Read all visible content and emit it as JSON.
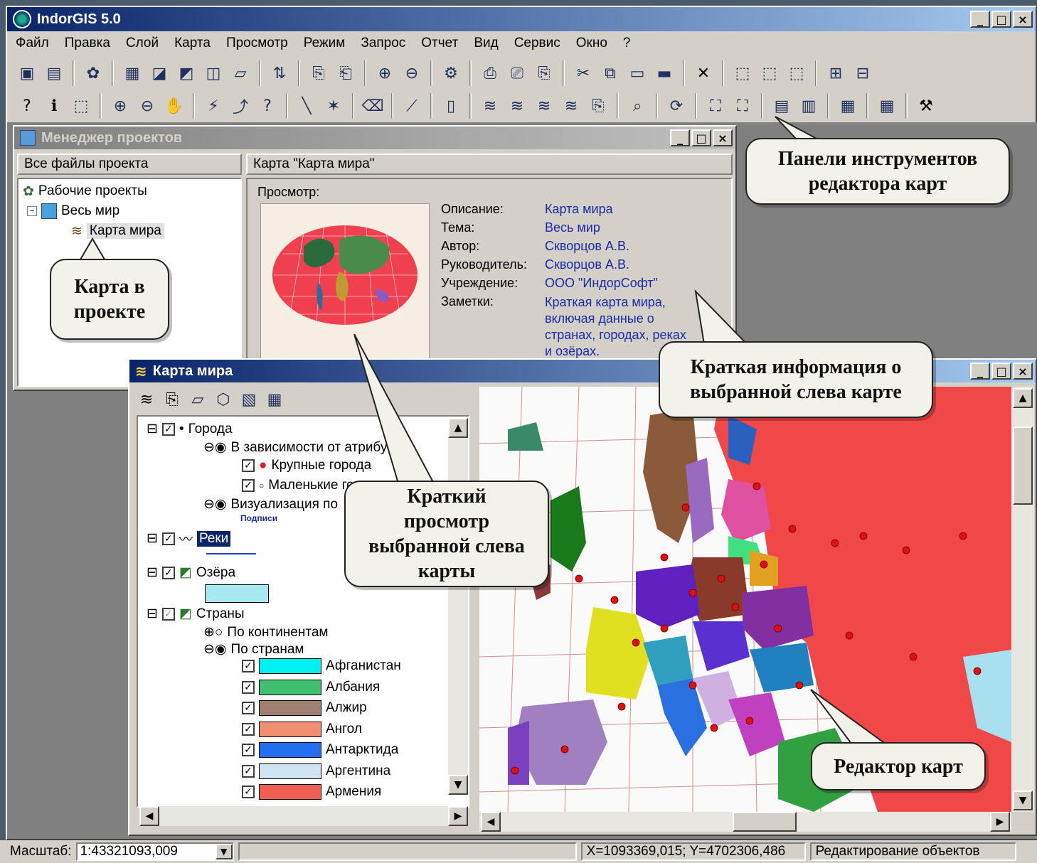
{
  "app": {
    "title": "IndorGIS 5.0"
  },
  "menu": [
    "Файл",
    "Правка",
    "Слой",
    "Карта",
    "Просмотр",
    "Режим",
    "Запрос",
    "Отчет",
    "Вид",
    "Сервис",
    "Окно",
    "?"
  ],
  "project_manager": {
    "title": "Менеджер проектов",
    "left_header": "Все файлы проекта",
    "right_header": "Карта \"Карта мира\"",
    "tree": [
      "Рабочие проекты",
      "Весь мир",
      "Карта мира"
    ],
    "preview_label": "Просмотр:",
    "info": [
      {
        "label": "Описание:",
        "value": "Карта мира"
      },
      {
        "label": "Тема:",
        "value": "Весь мир"
      },
      {
        "label": "Автор:",
        "value": "Скворцов А.В."
      },
      {
        "label": "Руководитель:",
        "value": "Скворцов А.В."
      },
      {
        "label": "Учреждение:",
        "value": "ООО \"ИндорСофт\""
      },
      {
        "label": "Заметки:",
        "value": "Краткая карта мира, включая данные о странах, городах, реках и озёрах."
      }
    ]
  },
  "map_window": {
    "title": "Карта мира",
    "layers": {
      "cities": "Города",
      "by_attr": "В зависимости от атрибута",
      "big": "Крупные города",
      "small": "Маленькие города",
      "visual": "Визуализация по",
      "labels": "Подписи",
      "rivers": "Реки",
      "lakes": "Озёра",
      "countries": "Страны",
      "by_continent": "По континентам",
      "by_country": "По странам"
    },
    "countries": [
      {
        "name": "Афганистан",
        "color": "#00f0f0"
      },
      {
        "name": "Албания",
        "color": "#40c070"
      },
      {
        "name": "Алжир",
        "color": "#a08070"
      },
      {
        "name": "Ангол",
        "color": "#f09070"
      },
      {
        "name": "Антарктида",
        "color": "#2070f0"
      },
      {
        "name": "Аргентина",
        "color": "#d0e4f4"
      },
      {
        "name": "Армения",
        "color": "#f06050"
      }
    ]
  },
  "callouts": {
    "toolbars": "Панели инструментов редактора карт",
    "map_in_project": "Карта в проекте",
    "brief_info": "Краткая информация о выбранной слева карте",
    "brief_view": "Краткий просмотр выбранной слева карты",
    "editor": "Редактор карт"
  },
  "status": {
    "scale_label": "Масштаб:",
    "scale_value": "1:43321093,009",
    "coords": "X=1093369,015; Y=4702306,486",
    "mode": "Редактирование объектов"
  }
}
